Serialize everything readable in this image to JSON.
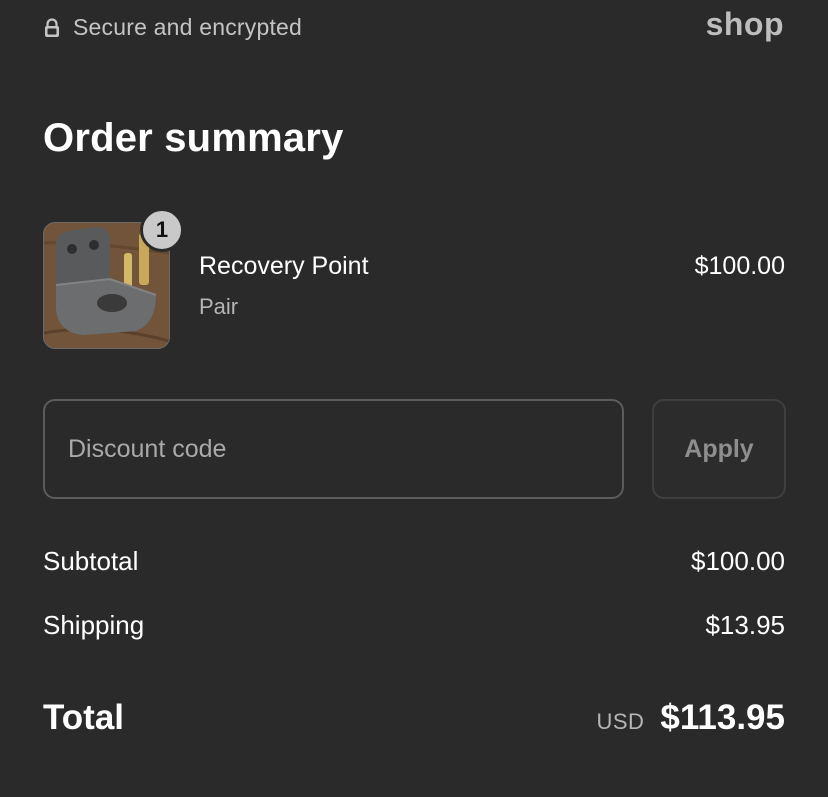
{
  "header": {
    "secure_text": "Secure and encrypted",
    "lock_icon": "lock-icon",
    "brand_logo": "shop"
  },
  "summary": {
    "title": "Order summary"
  },
  "line_item": {
    "image_alt": "Recovery Point product photo",
    "quantity": "1",
    "name": "Recovery Point",
    "variant": "Pair",
    "price": "$100.00"
  },
  "discount": {
    "placeholder": "Discount code",
    "value": "",
    "apply_label": "Apply"
  },
  "costs": {
    "subtotal_label": "Subtotal",
    "subtotal_value": "$100.00",
    "shipping_label": "Shipping",
    "shipping_value": "$13.95"
  },
  "total": {
    "label": "Total",
    "currency": "USD",
    "value": "$113.95"
  }
}
